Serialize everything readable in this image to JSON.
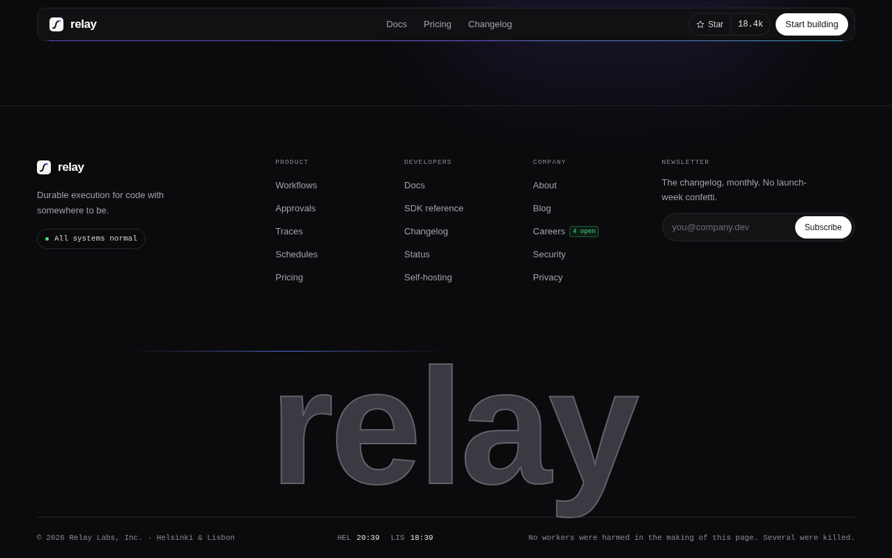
{
  "nav": {
    "brand": "relay",
    "links": [
      "Docs",
      "Pricing",
      "Changelog"
    ],
    "star": {
      "label": "Star",
      "count": "18.4k"
    },
    "cta": "Start building"
  },
  "footer": {
    "brand": "relay",
    "tagline": "Durable execution for code with somewhere to be.",
    "status": {
      "label": "All systems normal",
      "color": "#4ade80"
    },
    "columns": [
      {
        "title": "PRODUCT",
        "links": [
          {
            "label": "Workflows"
          },
          {
            "label": "Approvals"
          },
          {
            "label": "Traces"
          },
          {
            "label": "Schedules"
          },
          {
            "label": "Pricing"
          }
        ]
      },
      {
        "title": "DEVELOPERS",
        "links": [
          {
            "label": "Docs"
          },
          {
            "label": "SDK reference"
          },
          {
            "label": "Changelog"
          },
          {
            "label": "Status"
          },
          {
            "label": "Self-hosting"
          }
        ]
      },
      {
        "title": "COMPANY",
        "links": [
          {
            "label": "About"
          },
          {
            "label": "Blog"
          },
          {
            "label": "Careers",
            "badge": "4 open"
          },
          {
            "label": "Security"
          },
          {
            "label": "Privacy"
          }
        ]
      }
    ],
    "newsletter": {
      "title": "NEWSLETTER",
      "text": "The changelog, monthly. No launch-week confetti.",
      "placeholder": "you@company.dev",
      "button": "Subscribe"
    },
    "wordmark": "relay",
    "copyright": "© 2026 Relay Labs, Inc. · Helsinki & Lisbon",
    "clocks": [
      {
        "city": "HEL",
        "time": "20:39"
      },
      {
        "city": "LIS",
        "time": "18:39"
      }
    ],
    "note": "No workers were harmed in the making of this page. Several were killed."
  }
}
